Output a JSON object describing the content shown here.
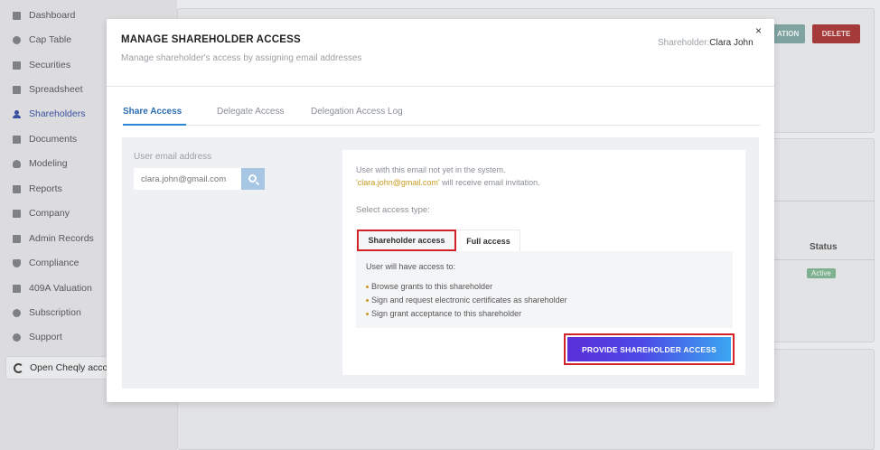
{
  "sidebar": {
    "items": [
      {
        "label": "Dashboard",
        "icon": "dashboard-icon"
      },
      {
        "label": "Cap Table",
        "icon": "pie-chart-icon"
      },
      {
        "label": "Securities",
        "icon": "clipboard-icon"
      },
      {
        "label": "Spreadsheet",
        "icon": "spreadsheet-icon"
      },
      {
        "label": "Shareholders",
        "icon": "person-icon",
        "active": true
      },
      {
        "label": "Documents",
        "icon": "folder-icon"
      },
      {
        "label": "Modeling",
        "icon": "lightbulb-icon"
      },
      {
        "label": "Reports",
        "icon": "report-icon"
      },
      {
        "label": "Company",
        "icon": "building-icon"
      },
      {
        "label": "Admin Records",
        "icon": "records-icon"
      },
      {
        "label": "Compliance",
        "icon": "shield-icon"
      },
      {
        "label": "409A Valuation",
        "icon": "valuation-icon"
      },
      {
        "label": "Subscription",
        "icon": "dollar-icon"
      },
      {
        "label": "Support",
        "icon": "support-icon"
      }
    ],
    "open_label": "Open Cheqly acco"
  },
  "background": {
    "verification_btn": "ATION",
    "delete_btn": "DELETE",
    "status_header": "Status",
    "status_badge": "Active",
    "accent_color": "#7fa3a0",
    "delete_color": "#a43a3a"
  },
  "modal": {
    "title": "MANAGE SHAREHOLDER ACCESS",
    "subtitle": "Manage shareholder's access by assigning email addresses",
    "shareholder_label": "Shareholder:",
    "shareholder_name": "Clara John",
    "close_symbol": "×",
    "tabs": [
      {
        "label": "Share Access",
        "active": true
      },
      {
        "label": "Delegate Access"
      },
      {
        "label": "Delegation Access Log"
      }
    ],
    "email_label": "User email address",
    "email_value": "clara.john@gmail.com",
    "notice_line1": "User with this email not yet in the system.",
    "notice_email": "'clara.john@gmail.com'",
    "notice_line2_rest": " will receive email invitation.",
    "select_label": "Select access type:",
    "access_tabs": [
      {
        "label": "Shareholder access",
        "active": true
      },
      {
        "label": "Full access"
      }
    ],
    "access_intro": "User will have access to:",
    "access_items": [
      "Browse grants to this shareholder",
      "Sign and request electronic certificates as shareholder",
      "Sign grant acceptance to this shareholder"
    ],
    "provide_btn": "PROVIDE SHAREHOLDER ACCESS",
    "colors": {
      "tab_active": "#2b6cb0",
      "highlight_border": "#d2232a",
      "email_highlight": "#c79a21",
      "btn_gradient_start": "#5a2fd8",
      "btn_gradient_end": "#3aa6f0"
    }
  }
}
